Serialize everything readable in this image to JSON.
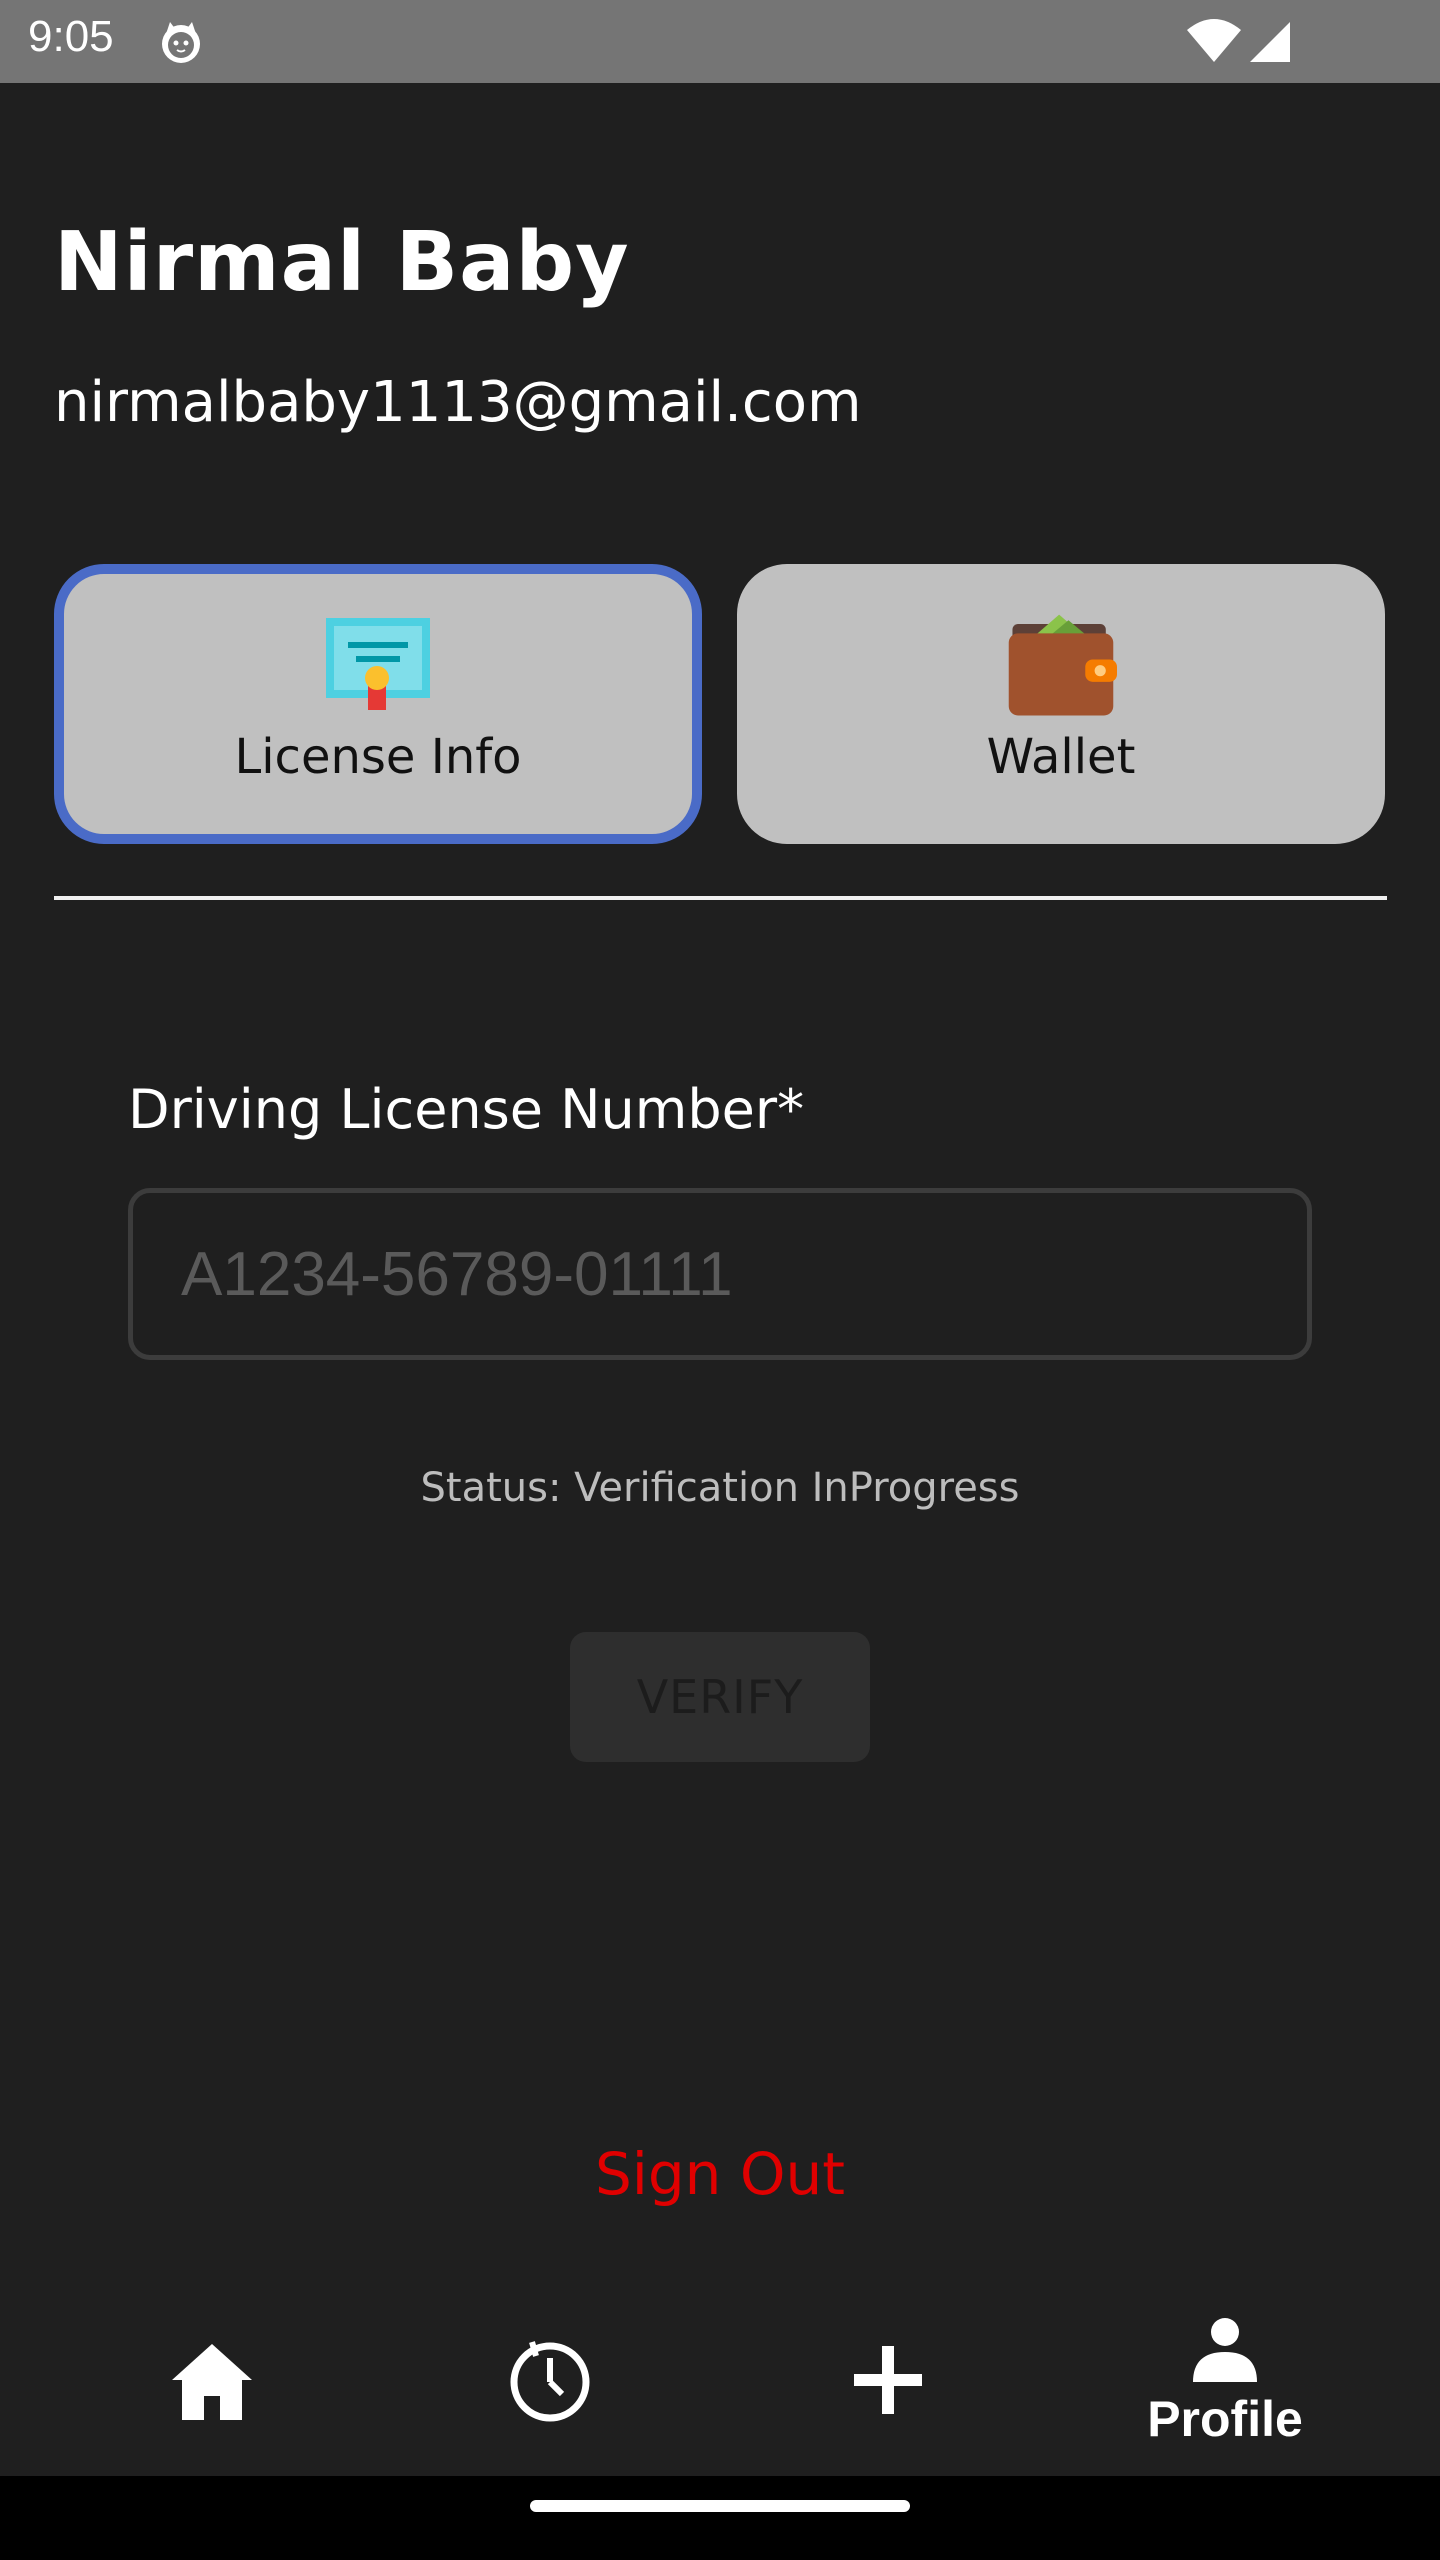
{
  "status_bar": {
    "time": "9:05",
    "icons": [
      "cat-notification-icon",
      "wifi-icon",
      "cell-signal-icon"
    ]
  },
  "profile": {
    "name": "Nirmal Baby",
    "email": "nirmalbaby1113@gmail.com"
  },
  "tabs": [
    {
      "label": "License Info",
      "icon": "license-certificate-icon",
      "active": true
    },
    {
      "label": "Wallet",
      "icon": "wallet-icon",
      "active": false
    }
  ],
  "license_form": {
    "label": "Driving License Number*",
    "placeholder": "A1234-56789-01111",
    "value": "",
    "status": "Status: Verification InProgress",
    "verify_label": "VERIFY"
  },
  "sign_out_label": "Sign Out",
  "bottom_nav": {
    "items": [
      {
        "icon": "home-icon",
        "label": ""
      },
      {
        "icon": "history-clock-icon",
        "label": ""
      },
      {
        "icon": "add-icon",
        "label": ""
      },
      {
        "icon": "profile-person-icon",
        "label": "Profile"
      }
    ]
  },
  "colors": {
    "background": "#1f1f1f",
    "status_bar": "#757575",
    "tab_card": "#c0c0c0",
    "active_tab_border": "#4a6bc7",
    "sign_out": "#e00000"
  }
}
